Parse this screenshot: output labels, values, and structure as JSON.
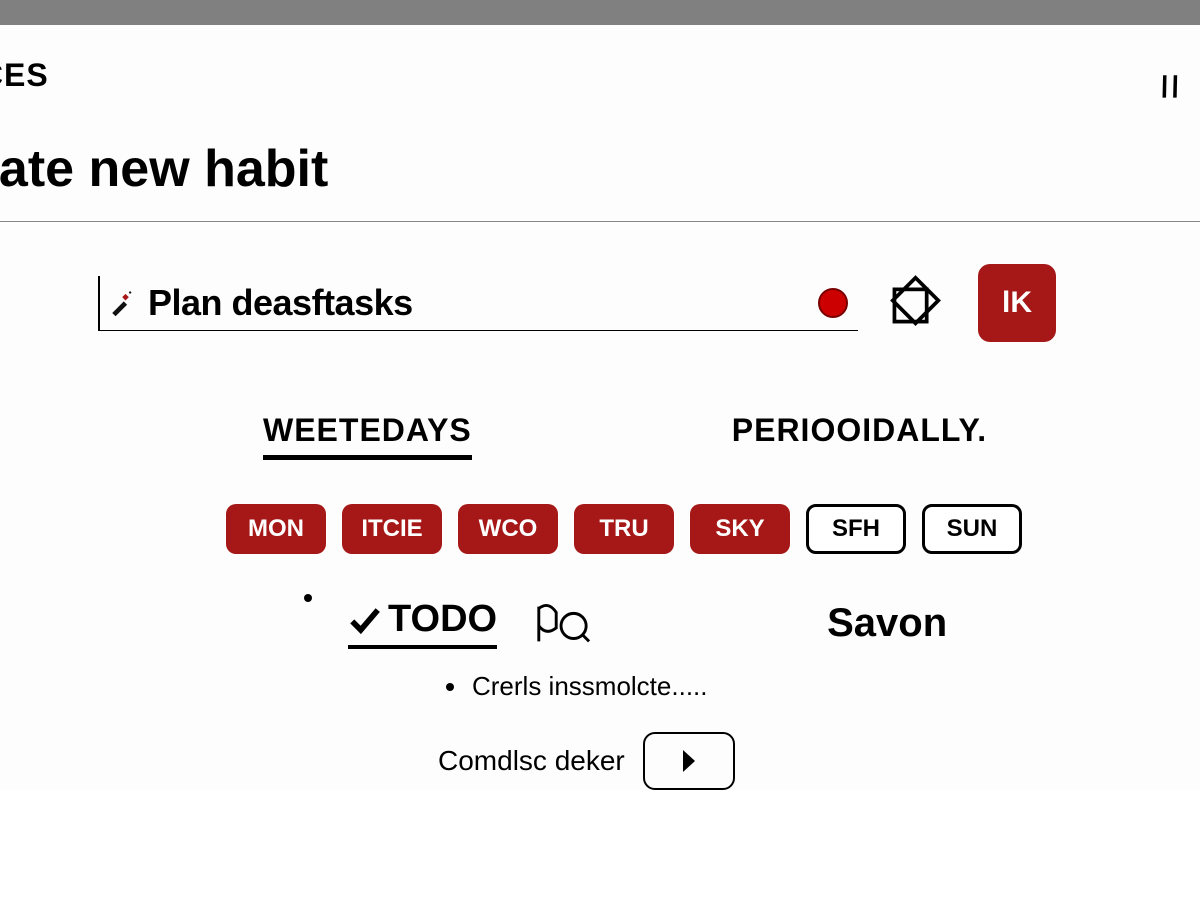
{
  "header": {
    "breadcrumb": "ICES",
    "close_glyph": "\\ \\"
  },
  "page": {
    "title": "eate new habit"
  },
  "habit": {
    "name_value": "Plan deasftasks",
    "color": "#cc0000",
    "badge_label": "lK"
  },
  "tabs": {
    "weekdays_label": "WEETEDAYS",
    "periodically_label": "PERIOOIDALLY.",
    "active": "weekdays"
  },
  "days": [
    {
      "label": "MON",
      "selected": true
    },
    {
      "label": "ITCIE",
      "selected": true
    },
    {
      "label": "WCO",
      "selected": true
    },
    {
      "label": "TRU",
      "selected": true
    },
    {
      "label": "SKY",
      "selected": true
    },
    {
      "label": "SFH",
      "selected": false
    },
    {
      "label": "SUN",
      "selected": false
    }
  ],
  "section": {
    "todo_label": "TODO",
    "save_label": "Savon",
    "hint_text": "Crerls inssmolcte.....",
    "stepper_label": "Comdlsc deker"
  }
}
